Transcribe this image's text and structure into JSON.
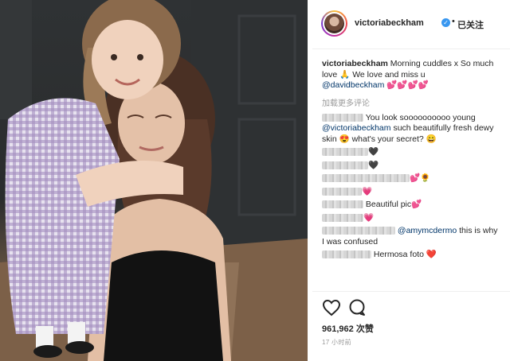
{
  "post": {
    "username": "victoriabeckham",
    "verified_icon": "verified-check-icon",
    "separator": "•",
    "follow_state": "已关注",
    "photo_description_icon": "photo"
  },
  "caption": {
    "user": "victoriabeckham",
    "text": "Morning cuddles x So much love",
    "emoji": "🙏",
    "text2": "We love and miss u",
    "mention": "@davidbeckham",
    "hearts": "💕💕💕💕"
  },
  "load_more": "加载更多评论",
  "comments": [
    {
      "text": "You look soooooooooo young ",
      "mention": "@victoriabeckham",
      "text2": " such beautifully fresh dewy skin 😍 what's your secret? 😄"
    },
    {
      "text": "",
      "suffix": "🖤"
    },
    {
      "text": "",
      "suffix": "🖤"
    },
    {
      "text": "",
      "suffix": "💕🌻"
    },
    {
      "text": "",
      "suffix": "💗"
    },
    {
      "text": "Beautiful pic💕"
    },
    {
      "text": "",
      "suffix": "💗"
    },
    {
      "mention": "@amymcdermo",
      "text2": " this is why I was confused"
    },
    {
      "text": "Hermosa foto ❤️"
    }
  ],
  "likes": "961,962 次赞",
  "timestamp": "17 小时前",
  "icons": {
    "like": "heart-outline-icon",
    "comment": "comment-bubble-icon"
  },
  "colors": {
    "link": "#003569",
    "verified": "#3897f0",
    "heart": "#e0245e"
  }
}
